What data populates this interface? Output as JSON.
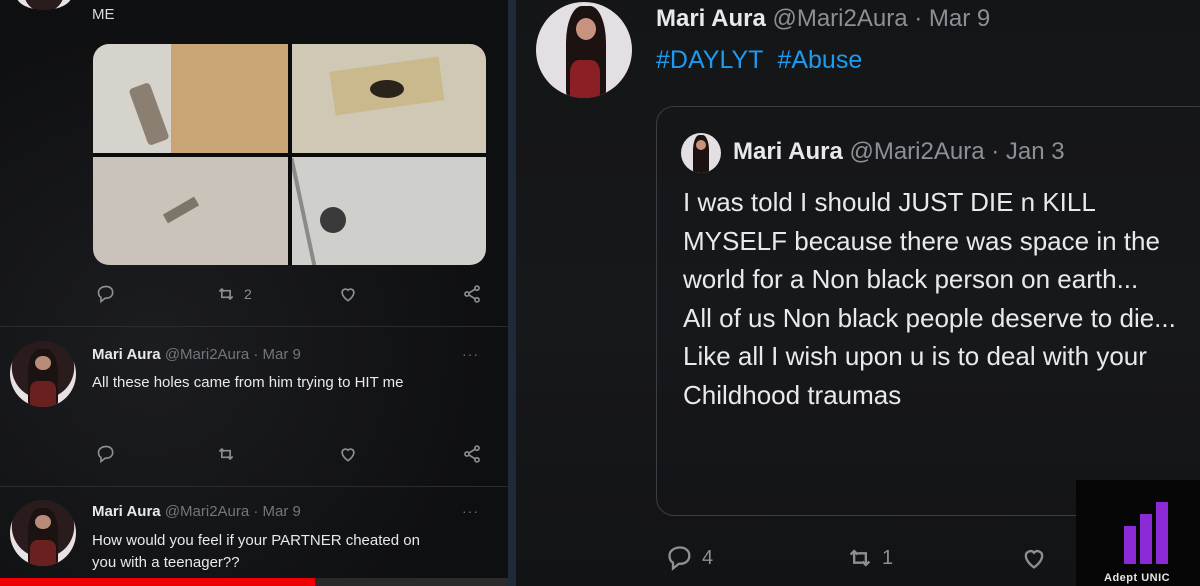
{
  "left_panel": {
    "top_tweet": {
      "text": "ME"
    },
    "top_actions": {
      "retweet_count": "2"
    },
    "tweet2": {
      "name": "Mari Aura",
      "meta": "@Mari2Aura · Mar 9",
      "more": "···",
      "text": "All these holes came from him trying to HIT me"
    },
    "tweet3": {
      "name": "Mari Aura",
      "meta": "@Mari2Aura · Mar 9",
      "more": "···",
      "text": "How would you feel if your PARTNER cheated on you with a teenager??"
    },
    "video_progress": 0.62
  },
  "right_panel": {
    "tweet": {
      "name": "Mari Aura",
      "meta": " @Mari2Aura · Mar 9",
      "hashtags": [
        "#DAYLYT",
        "#Abuse"
      ]
    },
    "quoted": {
      "name": "Mari Aura",
      "meta": " @Mari2Aura · Jan 3",
      "lines": [
        "I was told I should JUST DIE n KILL MYSELF because there was space in the world for a Non black person on earth...",
        "All of us Non black people deserve to die...",
        "Like all I wish upon u is to deal with your Childhood traumas"
      ]
    },
    "actions": {
      "reply_count": "4",
      "retweet_count": "1"
    }
  },
  "watermark": {
    "text": "Adept UNIC"
  },
  "colors": {
    "accent": "#1d9bf0",
    "progress": "#ee0000",
    "logo": "#8a2bd6"
  },
  "icons": [
    "reply-icon",
    "retweet-icon",
    "like-icon",
    "share-icon"
  ]
}
